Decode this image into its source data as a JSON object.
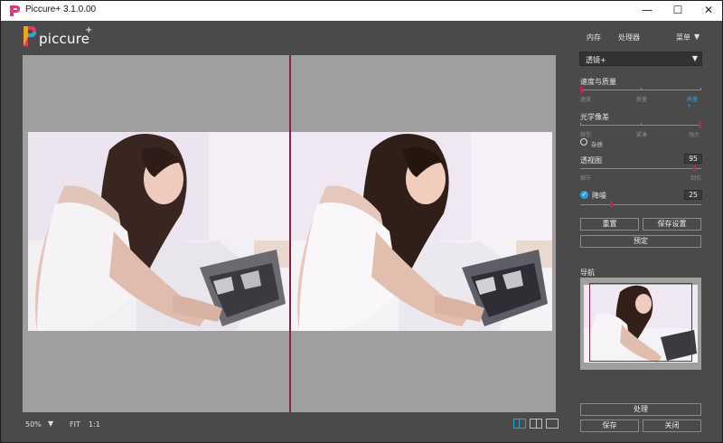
{
  "window": {
    "title": "Piccure+ 3.1.0.00",
    "controls": {
      "minimize": "—",
      "maximize": "☐",
      "close": "✕"
    }
  },
  "logo": {
    "text": "piccure",
    "plus": "+"
  },
  "colors": {
    "accent_red": "#8a1f45",
    "slider_red": "#c0244f",
    "accent_blue": "#29a3d8",
    "panel_bg": "#4a4a4a",
    "preview_bg": "#9f9f9f"
  },
  "top_menu": {
    "memory": "内存",
    "processor": "处理器",
    "menu": "菜单",
    "menu_caret": "▼"
  },
  "preset": {
    "value": "透镜+",
    "caret": "▼"
  },
  "speed_quality": {
    "label": "速度与质量",
    "sub": [
      "速度",
      "质量",
      "质量+"
    ],
    "level": 1.0
  },
  "optical_pixels": {
    "label": "光学像差",
    "sub": [
      "微型",
      "紧凑",
      "强大"
    ],
    "level": 1.0,
    "radio_label": "杂质"
  },
  "perspective": {
    "label": "透视图",
    "value": "95",
    "sub": [
      "细节",
      "到位"
    ],
    "level": 0.95
  },
  "denoise": {
    "label": "降噪",
    "value": "25",
    "checked": true,
    "level": 0.25
  },
  "buttons": {
    "reset": "重置",
    "save_settings": "保存设置",
    "default": "预定",
    "process": "处理",
    "save": "保存",
    "close": "关闭"
  },
  "navigator": {
    "label": "导航"
  },
  "bottom": {
    "zoom": "50%",
    "zoom_caret": "▼",
    "fit": "FIT",
    "one_to_one": "1:1"
  },
  "icons": {
    "app": "piccure-app-icon",
    "split_view": "split-view-icon",
    "side_by_side": "side-by-side-icon",
    "single_view": "single-view-icon",
    "check": "checkmark-icon"
  }
}
